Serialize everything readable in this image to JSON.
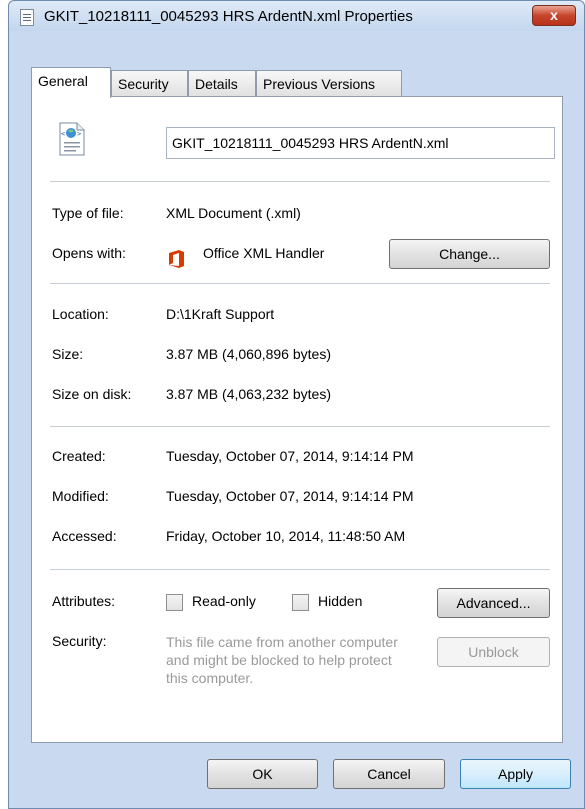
{
  "window": {
    "title": "GKIT_10218111_0045293 HRS ArdentN.xml Properties",
    "close_label": "x"
  },
  "tabs": [
    {
      "label": "General",
      "active": true
    },
    {
      "label": "Security",
      "active": false
    },
    {
      "label": "Details",
      "active": false
    },
    {
      "label": "Previous Versions",
      "active": false
    }
  ],
  "general": {
    "file_name": "GKIT_10218111_0045293 HRS ArdentN.xml",
    "type_label": "Type of file:",
    "type_value": "XML Document (.xml)",
    "opens_label": "Opens with:",
    "opens_value": "Office XML Handler",
    "change_button": "Change...",
    "location_label": "Location:",
    "location_value": "D:\\1Kraft Support",
    "size_label": "Size:",
    "size_value": "3.87 MB (4,060,896 bytes)",
    "size_disk_label": "Size on disk:",
    "size_disk_value": "3.87 MB (4,063,232 bytes)",
    "created_label": "Created:",
    "created_value": "Tuesday, October 07, 2014, 9:14:14 PM",
    "modified_label": "Modified:",
    "modified_value": "Tuesday, October 07, 2014, 9:14:14 PM",
    "accessed_label": "Accessed:",
    "accessed_value": "Friday, October 10, 2014, 11:48:50 AM",
    "attributes_label": "Attributes:",
    "readonly_label": "Read-only",
    "readonly_checked": false,
    "hidden_label": "Hidden",
    "hidden_checked": false,
    "advanced_button": "Advanced...",
    "security_label": "Security:",
    "security_text": "This file came from another computer and might be blocked to help protect this computer.",
    "unblock_button": "Unblock"
  },
  "footer": {
    "ok": "OK",
    "cancel": "Cancel",
    "apply": "Apply"
  },
  "colors": {
    "office_brand": "#d83b01",
    "close_red": "#c6452c"
  }
}
